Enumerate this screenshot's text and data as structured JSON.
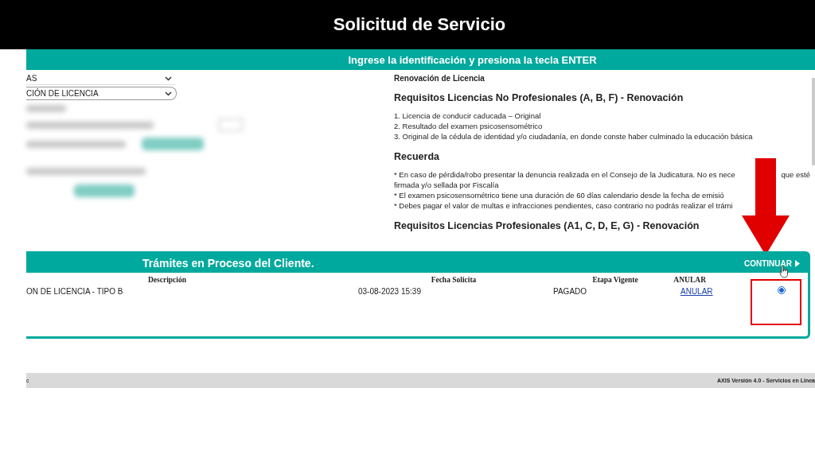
{
  "header": {
    "title": "Solicitud de Servicio"
  },
  "instruction_bar": {
    "text": "Ingrese la identificación y presiona la tecla ENTER"
  },
  "form": {
    "selects": [
      {
        "value": "AS"
      },
      {
        "value": "CIÓN DE LICENCIA"
      }
    ]
  },
  "info": {
    "subtitle": "Renovación de Licencia",
    "heading_1": "Requisitos Licencias No Profesionales (A, B, F) - Renovación",
    "requirements": [
      "1. Licencia de conducir caducada – Original",
      "2. Resultado del examen psicosensométrico",
      "3. Original de la cédula de identidad y/o ciudadanía, en donde conste haber culminado la educación básica"
    ],
    "heading_2": "Recuerda",
    "notes": [
      {
        "text": "* En caso de pérdida/robo presentar la denuncia realizada en el Consejo de la Judicatura. No es nece",
        "tail": "que esté"
      },
      {
        "text": "firmada y/o sellada por Fiscalía"
      },
      {
        "text": "* El examen psicosensométrico tiene una duración de 60 días calendario desde la fecha de emisió"
      },
      {
        "text": "* Debes pagar el valor de multas e infracciones pendientes, caso contrario no podrás realizar el trámi"
      }
    ],
    "heading_3": "Requisitos Licencias Profesionales (A1, C, D, E, G) - Renovación"
  },
  "process": {
    "title": "Trámites en Proceso del Cliente.",
    "continue": "CONTINUAR",
    "columns": [
      "Descripción",
      "Fecha Solicita",
      "Etapa Vigente",
      "ANULAR"
    ],
    "rows": [
      {
        "description": "ON DE LICENCIA - TIPO B",
        "date": "03-08-2023 15:39",
        "stage": "PAGADO",
        "cancel": "ANULAR",
        "selected": true
      }
    ]
  },
  "footer": {
    "left": "c",
    "right": "AXIS Versión 4.0 - Servicios en Linea"
  }
}
